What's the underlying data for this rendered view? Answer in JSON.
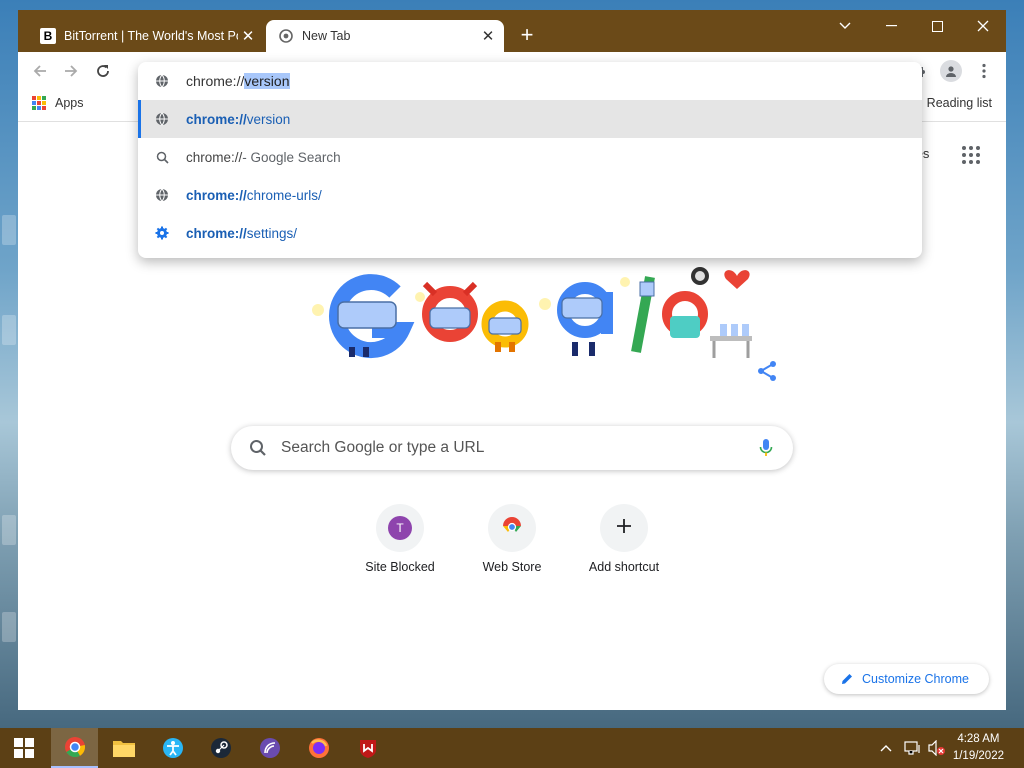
{
  "tabs": [
    {
      "title": "BitTorrent | The World's Most Popular Torrent Client",
      "favicon": "B"
    },
    {
      "title": "New Tab"
    }
  ],
  "omnibox": {
    "input_prefix": "chrome://",
    "input_selected": "version",
    "suggestions": [
      {
        "icon": "globe-icon",
        "bold": "chrome://",
        "rest": "version",
        "selected": true
      },
      {
        "icon": "search-icon",
        "plain": "chrome://",
        "rest": " - Google Search",
        "selected": false
      },
      {
        "icon": "globe-icon",
        "bold": "chrome://",
        "rest": "chrome-urls/",
        "selected": false
      },
      {
        "icon": "gear-icon",
        "bold": "chrome://",
        "rest": "settings/",
        "selected": false
      }
    ]
  },
  "bookmarks": {
    "apps_label": "Apps",
    "reading_list_label": "Reading list"
  },
  "ntp": {
    "images_label": "nages",
    "search_placeholder": "Search Google or type a URL",
    "shortcuts": [
      {
        "label": "Site Blocked",
        "icon_letter": "T"
      },
      {
        "label": "Web Store"
      },
      {
        "label": "Add shortcut"
      }
    ],
    "customize_label": "Customize Chrome"
  },
  "taskbar": {
    "time": "4:28 AM",
    "date": "1/19/2022"
  },
  "colors": {
    "titlebar": "#6b4a18",
    "taskbar": "#5c4015",
    "accent": "#1a73e8",
    "link": "#1a5fb4"
  }
}
